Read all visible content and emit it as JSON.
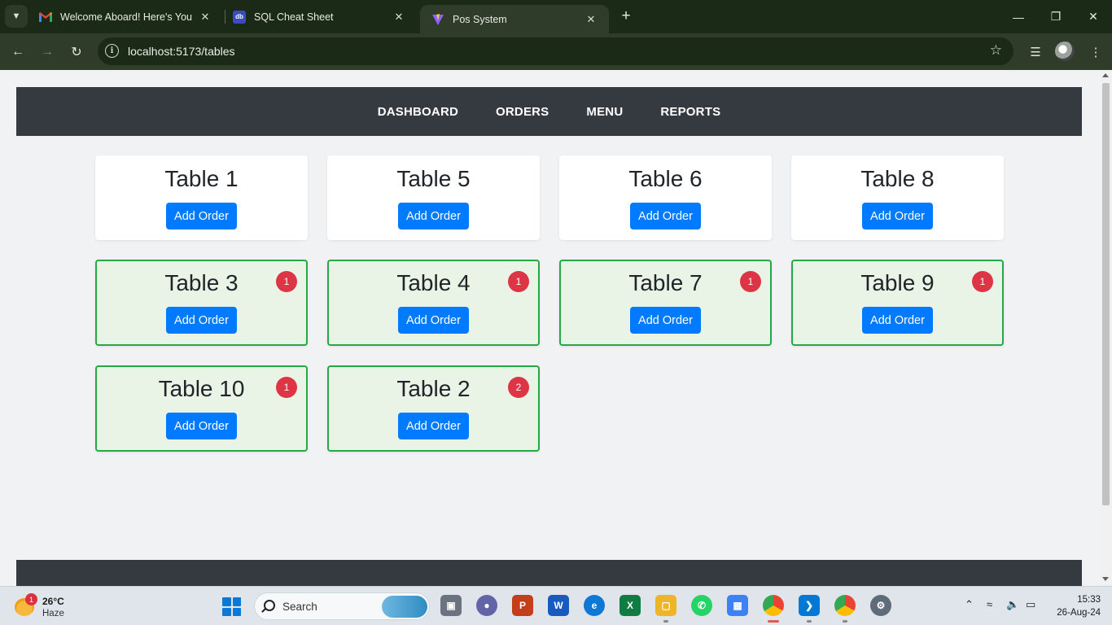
{
  "browser": {
    "tabs": [
      {
        "title": "Welcome Aboard! Here's Your S",
        "favicon": "gmail-icon"
      },
      {
        "title": "SQL Cheat Sheet",
        "favicon": "sql-icon"
      },
      {
        "title": "Pos System",
        "favicon": "vite-icon",
        "active": true
      }
    ],
    "url": "localhost:5173/tables"
  },
  "app": {
    "nav": {
      "dashboard": "DASHBOARD",
      "orders": "ORDERS",
      "menu": "MENU",
      "reports": "REPORTS"
    },
    "tables": [
      {
        "name": "Table 1",
        "button": "Add Order",
        "occupied": false,
        "badge": ""
      },
      {
        "name": "Table 5",
        "button": "Add Order",
        "occupied": false,
        "badge": ""
      },
      {
        "name": "Table 6",
        "button": "Add Order",
        "occupied": false,
        "badge": ""
      },
      {
        "name": "Table 8",
        "button": "Add Order",
        "occupied": false,
        "badge": ""
      },
      {
        "name": "Table 3",
        "button": "Add Order",
        "occupied": true,
        "badge": "1"
      },
      {
        "name": "Table 4",
        "button": "Add Order",
        "occupied": true,
        "badge": "1"
      },
      {
        "name": "Table 7",
        "button": "Add Order",
        "occupied": true,
        "badge": "1"
      },
      {
        "name": "Table 9",
        "button": "Add Order",
        "occupied": true,
        "badge": "1"
      },
      {
        "name": "Table 10",
        "button": "Add Order",
        "occupied": true,
        "badge": "1"
      },
      {
        "name": "Table 2",
        "button": "Add Order",
        "occupied": true,
        "badge": "2"
      }
    ],
    "colors": {
      "nav_bg": "#343a40",
      "button": "#007bff",
      "occupied_border": "#28a745",
      "occupied_bg": "#e9f4e7",
      "badge": "#dc3545"
    }
  },
  "taskbar": {
    "weather": {
      "temp": "26°C",
      "condition": "Haze",
      "badge": "1"
    },
    "search_label": "Search",
    "time": "15:33",
    "date": "26-Aug-24"
  }
}
